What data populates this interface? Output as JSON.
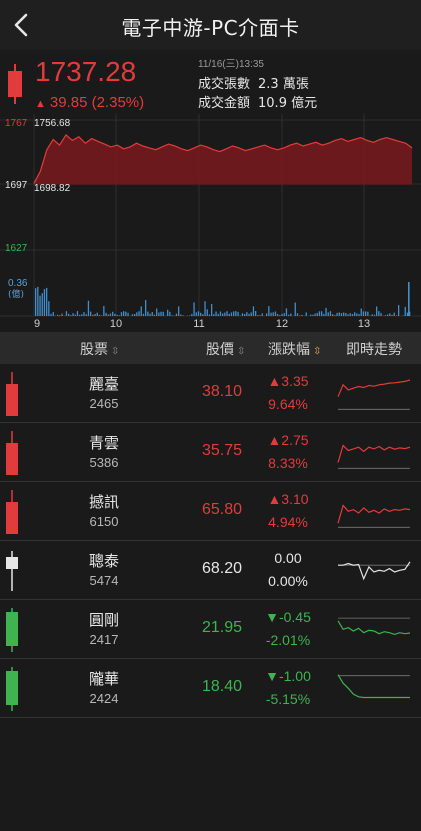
{
  "header": {
    "title": "電子中游-PC介面卡"
  },
  "quote": {
    "price": "1737.28",
    "change": "39.85 (2.35%)",
    "timestamp": "11/16(三)13:35",
    "volume_label": "成交張數",
    "volume_value": "2.3 萬張",
    "amount_label": "成交金額",
    "amount_value": "10.9 億元"
  },
  "chart_data": {
    "type": "area",
    "y_ticks": [
      "1767",
      "1697",
      "1627"
    ],
    "high_label": "1756.68",
    "low_label": "1698.82",
    "volume_label": "0.36",
    "volume_unit": "(億)",
    "x_ticks": [
      "9",
      "10",
      "11",
      "12",
      "13"
    ],
    "ylim": [
      1627,
      1767
    ],
    "open": 1697.43,
    "values": [
      1698.8,
      1712,
      1735,
      1746,
      1740,
      1751,
      1745,
      1749,
      1742,
      1747,
      1744,
      1741,
      1738,
      1740,
      1736,
      1738,
      1742,
      1739,
      1737,
      1735,
      1738,
      1741,
      1739,
      1736,
      1734,
      1737,
      1740,
      1738,
      1735,
      1733,
      1736,
      1739,
      1737,
      1734,
      1736,
      1738,
      1740,
      1737,
      1735,
      1737,
      1740,
      1742,
      1739,
      1741,
      1743,
      1740,
      1742,
      1745,
      1747,
      1744,
      1746,
      1748,
      1745,
      1743,
      1746,
      1748,
      1746,
      1744,
      1742,
      1737
    ]
  },
  "table": {
    "headers": {
      "stock": "股票",
      "price": "股價",
      "change": "漲跌幅",
      "trend": "即時走勢"
    },
    "rows": [
      {
        "name": "麗臺",
        "code": "2465",
        "price": "38.10",
        "change": "▲3.35",
        "pct": "9.64%",
        "dir": "up",
        "spark": [
          0.55,
          0.2,
          0.35,
          0.3,
          0.25,
          0.28,
          0.22,
          0.24,
          0.2,
          0.18,
          0.15,
          0.14,
          0.12,
          0.1,
          0.06
        ],
        "base": 0.92
      },
      {
        "name": "青雲",
        "code": "5386",
        "price": "35.75",
        "change": "▲2.75",
        "pct": "8.33%",
        "dir": "up",
        "spark": [
          0.75,
          0.25,
          0.4,
          0.35,
          0.3,
          0.42,
          0.3,
          0.35,
          0.28,
          0.38,
          0.3,
          0.36,
          0.32,
          0.34,
          0.3
        ],
        "base": 0.92
      },
      {
        "name": "撼訊",
        "code": "6150",
        "price": "65.80",
        "change": "▲3.10",
        "pct": "4.94%",
        "dir": "up",
        "spark": [
          0.8,
          0.28,
          0.45,
          0.4,
          0.5,
          0.35,
          0.48,
          0.42,
          0.5,
          0.38,
          0.45,
          0.4,
          0.42,
          0.38,
          0.4
        ],
        "base": 0.92
      },
      {
        "name": "聰泰",
        "code": "5474",
        "price": "68.20",
        "change": "0.00",
        "pct": "0.00%",
        "dir": "flat",
        "spark": [
          0.3,
          0.3,
          0.25,
          0.3,
          0.28,
          0.7,
          0.35,
          0.5,
          0.45,
          0.48,
          0.4,
          0.5,
          0.45,
          0.42,
          0.2
        ],
        "base": 0.3
      },
      {
        "name": "圓剛",
        "code": "2417",
        "price": "21.95",
        "change": "▼-0.45",
        "pct": "-2.01%",
        "dir": "dn",
        "spark": [
          0.2,
          0.45,
          0.4,
          0.5,
          0.42,
          0.55,
          0.48,
          0.5,
          0.58,
          0.52,
          0.55,
          0.6,
          0.55,
          0.58,
          0.56
        ],
        "base": 0.12
      },
      {
        "name": "隴華",
        "code": "2424",
        "price": "18.40",
        "change": "▼-1.00",
        "pct": "-5.15%",
        "dir": "dn",
        "spark": [
          0.05,
          0.3,
          0.45,
          0.62,
          0.7,
          0.72,
          0.72,
          0.72,
          0.72,
          0.72,
          0.72,
          0.72,
          0.72,
          0.72,
          0.72
        ],
        "base": 0.08
      }
    ]
  }
}
